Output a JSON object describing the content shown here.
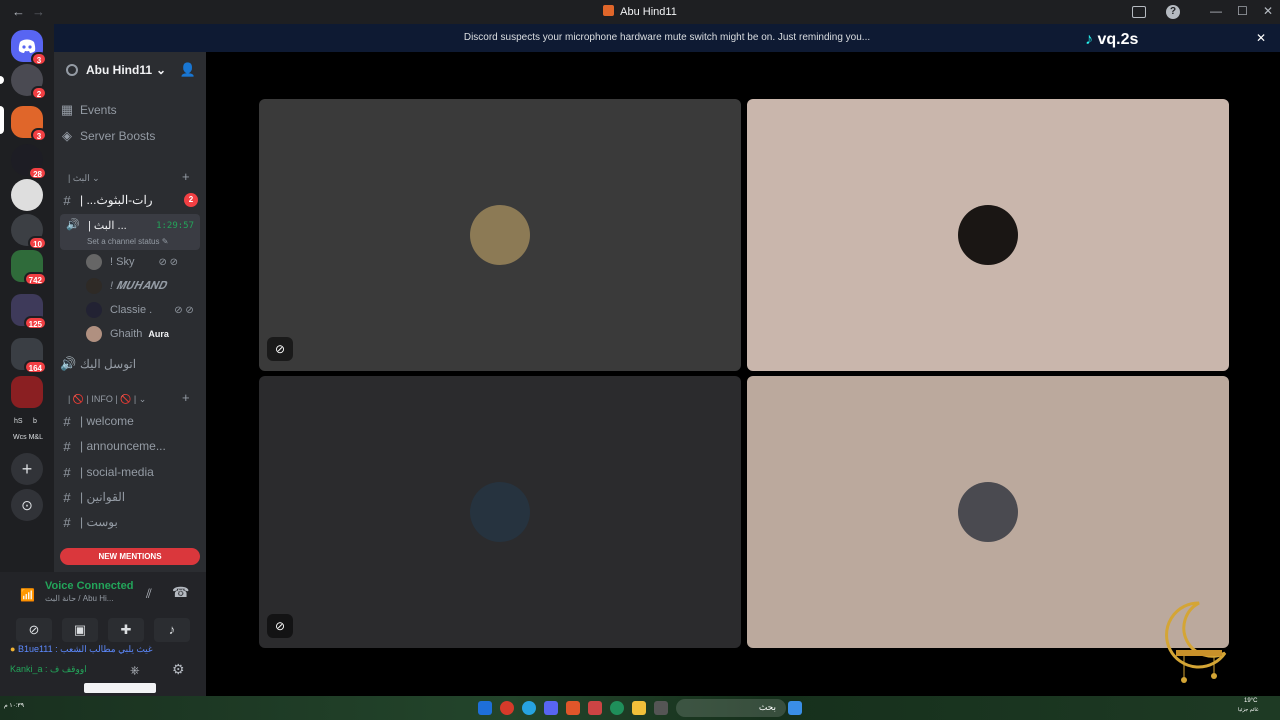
{
  "titlebar": {
    "back": "←",
    "forward": "→",
    "title": "Abu Hind11",
    "inbox_icon": "inbox-icon",
    "help": "?",
    "minimize": "—",
    "maximize": "☐",
    "close": "✕"
  },
  "banner": {
    "message": "Discord suspects your microphone hardware mute switch might be on. Just reminding you...",
    "close": "✕"
  },
  "watermark": "vq.2s",
  "guilds": {
    "badges": [
      "3",
      "2",
      "3",
      "28",
      "10",
      "742",
      "125",
      "164"
    ],
    "folder_labels": [
      "hS",
      "b",
      "Wcs M&L"
    ],
    "add": "+",
    "discover": "⊙"
  },
  "server": {
    "name": "Abu Hind11",
    "chevron": "⌄",
    "invite_icon": "add-member-icon",
    "events": "Events",
    "boosts": "Server Boosts",
    "category1": "| البث ⌄",
    "channel_locked": "| ...رات-البثوث",
    "channel_locked_badge": "2",
    "voice_channel": "| البث ...",
    "voice_timer": "1:29:57",
    "voice_status": "Set a channel status ✎",
    "members": [
      {
        "name": "! Sky",
        "tag": ""
      },
      {
        "name": "! 𝑴𝑼𝑯𝑨𝑵𝑫",
        "tag": ""
      },
      {
        "name": "Classie .",
        "tag": ""
      },
      {
        "name": "Ghaith",
        "tag": "Aura"
      }
    ],
    "voice_channel2": "اتوسل اليك",
    "category2": "| 🚫 | INFO | 🚫 | ⌄",
    "text_channels": [
      "| welcome",
      "| announceme...",
      "| social-media",
      "| القوانين",
      "| بوست"
    ],
    "new_mentions": "NEW MENTIONS"
  },
  "voice_panel": {
    "title": "Voice Connected",
    "subtitle": "حانة البث / Abu Hi...",
    "user1": "B1ue111 : غيث يلبي مطالب الشعب",
    "user2": "Kanki_a : اووقف ف"
  },
  "tiles": [
    {
      "bg": "#3a3a3a",
      "avatar": "#8c7a55",
      "muted": true
    },
    {
      "bg": "#c9b6ac",
      "avatar": "#1a1614",
      "muted": false
    },
    {
      "bg": "#2b2b2d",
      "avatar": "#26333f",
      "muted": true
    },
    {
      "bg": "#bba99d",
      "avatar": "#4a4a50",
      "muted": false
    }
  ],
  "taskbar": {
    "search_text": "بحث",
    "weather": "19°C",
    "weather_sub": "غائم جزئيا",
    "time_left": "١٠:٣٩ م"
  },
  "colors": {
    "accent_green": "#23a55a",
    "mention_red": "#da373c",
    "banner_blue": "#0e1a33"
  }
}
